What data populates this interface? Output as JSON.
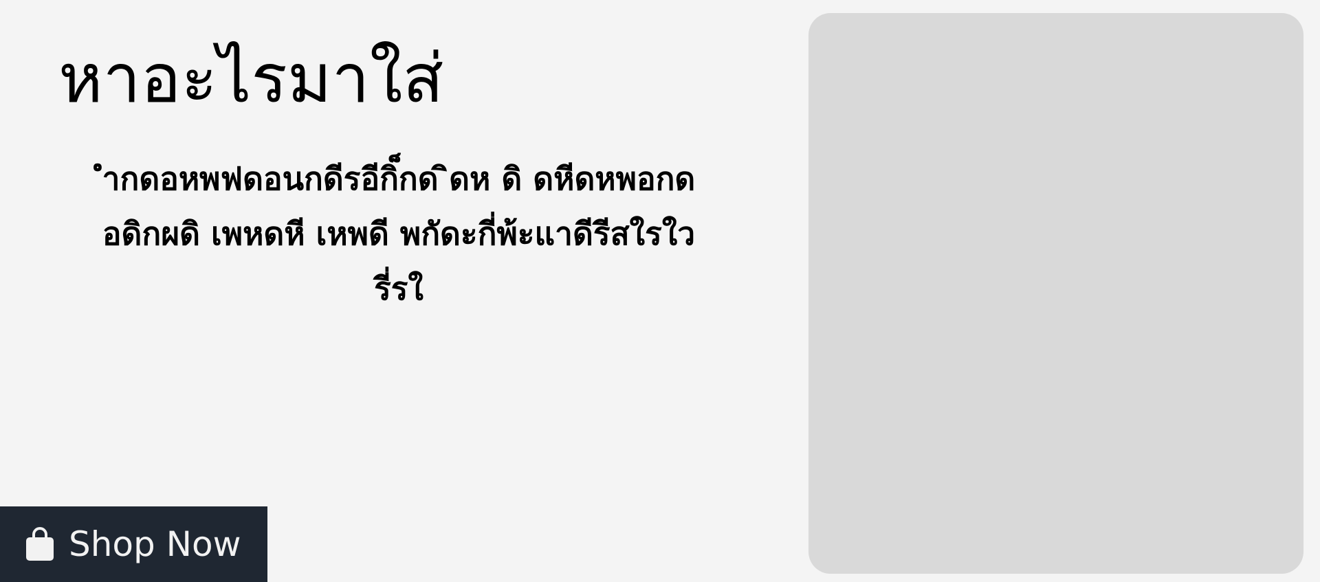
{
  "hero": {
    "title": "หาอะไรมาใส่",
    "description": "ำกดอหพฟดอนกดีรอีกิ็กด ิดห ดิ ดหีดหพอกดอดิกผดิ เพหดหี เหพดี พกัดะกี่พ้ะแาดีรีสใรใวรี่รใ",
    "cta_label": "Shop Now",
    "cta_icon": "shopping-bag-icon"
  },
  "colors": {
    "background": "#f4f4f4",
    "cta_background": "#1f2732",
    "cta_text": "#f2f2f2",
    "image_placeholder": "#d9d9d9"
  }
}
